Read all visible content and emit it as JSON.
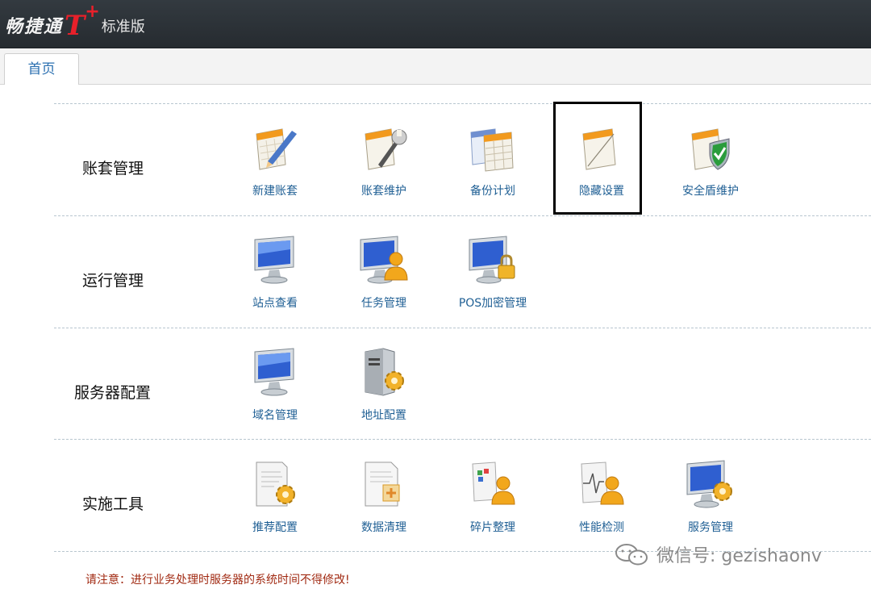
{
  "header": {
    "logo_main": "畅捷通",
    "logo_t": "T",
    "logo_plus": "+",
    "logo_edition": "标准版"
  },
  "tabs": [
    {
      "label": "首页"
    }
  ],
  "sections": [
    {
      "title": "账套管理",
      "items": [
        {
          "label": "新建账套",
          "icon": "new-account-icon"
        },
        {
          "label": "账套维护",
          "icon": "account-maintenance-icon"
        },
        {
          "label": "备份计划",
          "icon": "backup-plan-icon"
        },
        {
          "label": "隐藏设置",
          "icon": "hidden-settings-icon"
        },
        {
          "label": "安全盾维护",
          "icon": "security-shield-icon"
        }
      ]
    },
    {
      "title": "运行管理",
      "items": [
        {
          "label": "站点查看",
          "icon": "site-monitor-icon"
        },
        {
          "label": "任务管理",
          "icon": "task-user-monitor-icon"
        },
        {
          "label": "POS加密管理",
          "icon": "pos-lock-monitor-icon"
        }
      ]
    },
    {
      "title": "服务器配置",
      "items": [
        {
          "label": "域名管理",
          "icon": "domain-monitor-icon"
        },
        {
          "label": "地址配置",
          "icon": "server-gear-icon"
        }
      ]
    },
    {
      "title": "实施工具",
      "items": [
        {
          "label": "推荐配置",
          "icon": "recommend-config-icon"
        },
        {
          "label": "数据清理",
          "icon": "data-cleanup-icon"
        },
        {
          "label": "碎片整理",
          "icon": "defrag-icon"
        },
        {
          "label": "性能检测",
          "icon": "performance-icon"
        },
        {
          "label": "服务管理",
          "icon": "service-monitor-icon"
        }
      ]
    }
  ],
  "notice": "请注意：进行业务处理时服务器的系统时间不得修改!",
  "watermark": "微信号: gezishaonv",
  "colors": {
    "topbar": "#2b3136",
    "label": "#1f5f94",
    "notice": "#a12a12",
    "logo_t": "#e8202a"
  }
}
